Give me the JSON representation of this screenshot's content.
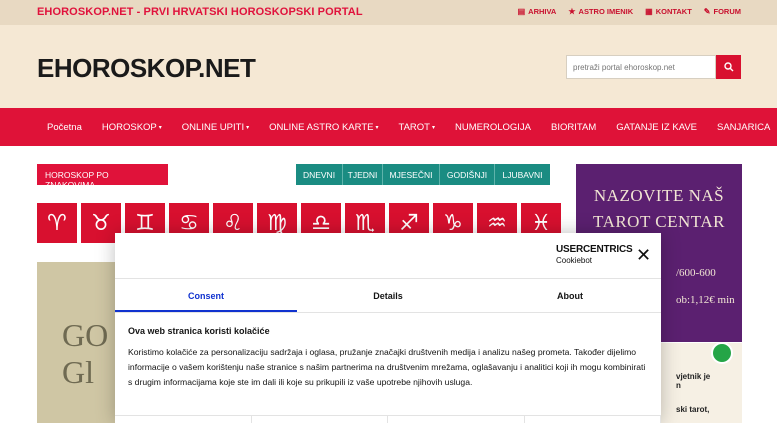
{
  "topbar": {
    "tagline": "EHOROSKOP.NET - PRVI HRVATSKI HOROSKOPSKI PORTAL",
    "links": [
      {
        "icon": "archive-icon",
        "glyph": "▤",
        "label": "ARHIVA"
      },
      {
        "icon": "star-icon",
        "glyph": "★",
        "label": "ASTRO IMENIK"
      },
      {
        "icon": "contact-icon",
        "glyph": "▦",
        "label": "KONTAKT"
      },
      {
        "icon": "edit-icon",
        "glyph": "✎",
        "label": "FORUM"
      }
    ]
  },
  "header": {
    "logo": "EHOROSKOP.NET",
    "search_placeholder": "pretraži portal ehoroskop.net"
  },
  "nav": {
    "items": [
      {
        "label": "Početna",
        "caret": ""
      },
      {
        "label": "HOROSKOP",
        "caret": "▾"
      },
      {
        "label": "ONLINE UPITI",
        "caret": "▾"
      },
      {
        "label": "ONLINE ASTRO KARTE",
        "caret": "▾"
      },
      {
        "label": "TAROT",
        "caret": "▾"
      },
      {
        "label": "NUMEROLOGIJA",
        "caret": ""
      },
      {
        "label": "BIORITAM",
        "caret": ""
      },
      {
        "label": "GATANJE IZ KAVE",
        "caret": ""
      },
      {
        "label": "SANJARICA",
        "caret": ""
      }
    ]
  },
  "section": {
    "label": "HOROSKOP PO ZNAKOVIMA",
    "periods": [
      "DNEVNI",
      "TJEDNI",
      "MJESEČNI",
      "GODIŠNJI",
      "LJUBAVNI"
    ]
  },
  "zodiac": [
    {
      "name": "aries",
      "glyph": "♈"
    },
    {
      "name": "taurus",
      "glyph": "♉"
    },
    {
      "name": "gemini",
      "glyph": "♊"
    },
    {
      "name": "cancer",
      "glyph": "♋"
    },
    {
      "name": "leo",
      "glyph": "♌"
    },
    {
      "name": "virgo",
      "glyph": "♍"
    },
    {
      "name": "libra",
      "glyph": "♎"
    },
    {
      "name": "scorpio",
      "glyph": "♏"
    },
    {
      "name": "sagittarius",
      "glyph": "♐"
    },
    {
      "name": "capricorn",
      "glyph": "♑"
    },
    {
      "name": "aquarius",
      "glyph": "♒"
    },
    {
      "name": "pisces",
      "glyph": "♓"
    }
  ],
  "promo": {
    "line1": "GO",
    "line2": "Gl"
  },
  "tarot_ad": {
    "line1": "NAZOVITE NAŠ",
    "line2": "TAROT CENTAR",
    "phone": "/600-600",
    "price": "ob:1,12€ min"
  },
  "sidebar_card": {
    "line1": "vjetnik je",
    "line2": "n",
    "line3": "ski tarot,"
  },
  "consent": {
    "brand_main": "USERCENTRICS",
    "brand_sub": "Cookiebot",
    "close_glyph": "✕",
    "tabs": [
      "Consent",
      "Details",
      "About"
    ],
    "title": "Ova web stranica koristi kolačiće",
    "body": "Koristimo kolačiće za personalizaciju sadržaja i oglasa, pružanje značajki društvenih medija i analizu našeg prometa. Također dijelimo informacije o vašem korištenju naše stranice s našim partnerima na društvenim mrežama, oglašavanju i analitici koji ih mogu kombinirati s drugim informacijama koje ste im dali ili koje su prikupili iz vaše upotrebe njihovih usluga."
  },
  "colors": {
    "brand_red": "#df1238",
    "teal": "#1a8c82",
    "header_bg": "#f5e8d4",
    "tarot_purple": "#5b2070",
    "consent_blue": "#1032cf"
  }
}
